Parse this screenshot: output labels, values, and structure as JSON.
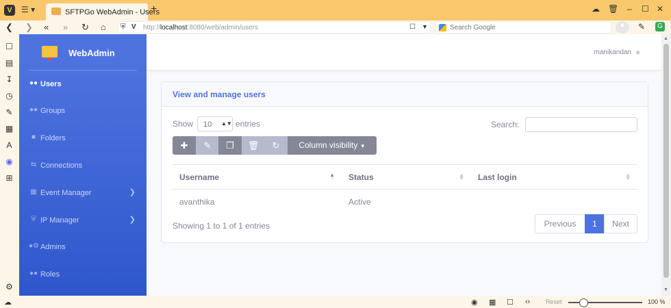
{
  "browser": {
    "tab_title": "SFTPGo WebAdmin - Users",
    "new_tab_label": "+",
    "url_host": "localhost",
    "url_prefix": "http://",
    "url_rest": ":8080/web/admin/users",
    "search_placeholder": "Search Google",
    "reset_label": "Reset",
    "zoom_label": "100 %",
    "zoom_level": 1.0
  },
  "sidebar": {
    "brand": "WebAdmin",
    "logo_text": "SFTPGo",
    "items": [
      {
        "label": "Users",
        "icon": "users-icon",
        "active": true
      },
      {
        "label": "Groups",
        "icon": "user-group-icon",
        "active": false
      },
      {
        "label": "Folders",
        "icon": "folder-icon",
        "active": false
      },
      {
        "label": "Connections",
        "icon": "exchange-icon",
        "active": false
      },
      {
        "label": "Event Manager",
        "icon": "calendar-icon",
        "active": false,
        "arrow": true
      },
      {
        "label": "IP Manager",
        "icon": "shield-icon",
        "active": false,
        "arrow": true
      },
      {
        "label": "Admins",
        "icon": "user-cog-icon",
        "active": false
      },
      {
        "label": "Roles",
        "icon": "user-tag-icon",
        "active": false
      }
    ]
  },
  "topbar": {
    "username": "manikandan"
  },
  "card": {
    "title": "View and manage users",
    "show_label": "Show",
    "length_value": "10",
    "entries_label": "entries",
    "search_label": "Search:",
    "search_value": "",
    "column_visibility": "Column visibility",
    "table": {
      "headers": [
        "Username",
        "Status",
        "Last login"
      ],
      "rows": [
        [
          "avanthika",
          "Active",
          ""
        ]
      ]
    },
    "info": "Showing 1 to 1 of 1 entries",
    "pager": {
      "previous": "Previous",
      "page": "1",
      "next": "Next"
    }
  },
  "colors": {
    "sidebar_top": "#4e73df",
    "sidebar_bottom": "#2f57cc",
    "tabbar": "#f9c86d",
    "accent": "#4e73df",
    "button_gray": "#858796"
  }
}
